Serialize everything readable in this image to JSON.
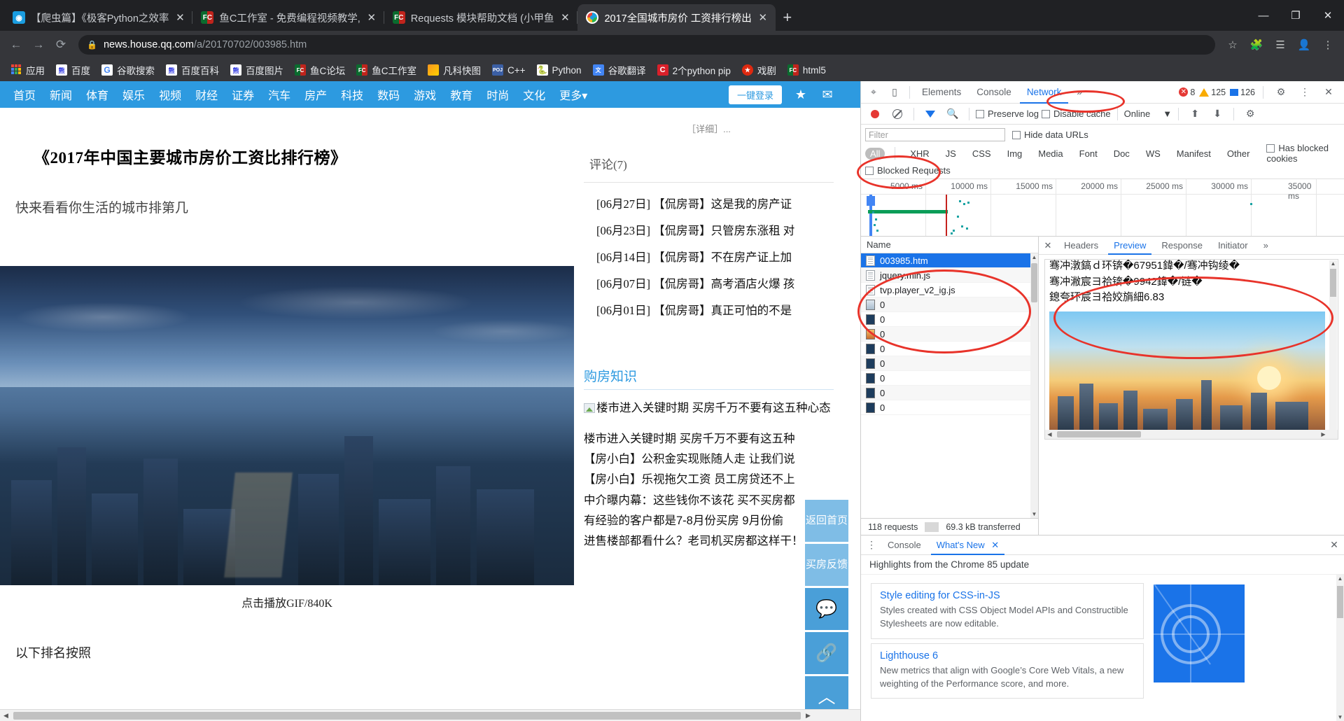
{
  "window": {
    "minimize": "—",
    "maximize": "❐",
    "close": "✕"
  },
  "tabs": [
    {
      "title": "【爬虫篇】《极客Python之效率",
      "icon": "robot-icon",
      "active": false
    },
    {
      "title": "鱼C工作室 - 免费编程视频教学,",
      "icon": "fc-icon",
      "active": false
    },
    {
      "title": "Requests 模块帮助文档 (小甲鱼",
      "icon": "fc-icon",
      "active": false
    },
    {
      "title": "2017全国城市房价 工资排行榜出",
      "icon": "qq-icon",
      "active": true
    }
  ],
  "newtab_label": "+",
  "toolbar": {
    "back": "←",
    "forward": "→",
    "reload": "⟳",
    "lock": "🔒",
    "url_host": "news.house.qq.com",
    "url_path": "/a/20170702/003985.htm",
    "star": "☆",
    "extensions": "🧩",
    "reading_list": "☰",
    "profile": "👤",
    "menu": "⋮"
  },
  "bookmarks": [
    {
      "label": "应用",
      "icon": "apps-grid-icon",
      "type": "apps"
    },
    {
      "label": "百度",
      "icon": "baidu-icon",
      "type": "baidu"
    },
    {
      "label": "谷歌搜索",
      "icon": "google-icon",
      "type": "google"
    },
    {
      "label": "百度百科",
      "icon": "baidu-icon",
      "type": "baidu"
    },
    {
      "label": "百度图片",
      "icon": "baidu-icon",
      "type": "baidu"
    },
    {
      "label": "鱼C论坛",
      "icon": "fc-icon",
      "type": "fc"
    },
    {
      "label": "鱼C工作室",
      "icon": "fc-icon",
      "type": "fc"
    },
    {
      "label": "凡科快图",
      "icon": "fanke-icon",
      "type": "fan"
    },
    {
      "label": "C++",
      "icon": "poj-icon",
      "type": "poj"
    },
    {
      "label": "Python",
      "icon": "python-icon",
      "type": "py"
    },
    {
      "label": "谷歌翻译",
      "icon": "google-translate-icon",
      "type": "gt"
    },
    {
      "label": "2个python pip",
      "icon": "c-icon",
      "type": "c"
    },
    {
      "label": "戏剧",
      "icon": "china-icon",
      "type": "cn"
    },
    {
      "label": "html5",
      "icon": "fc-icon",
      "type": "h5"
    }
  ],
  "page": {
    "nav": [
      "首页",
      "新闻",
      "体育",
      "娱乐",
      "视频",
      "财经",
      "证券",
      "汽车",
      "房产",
      "科技",
      "数码",
      "游戏",
      "教育",
      "时尚",
      "文化",
      "更多▾"
    ],
    "login_button": "一键登录",
    "star_icon": "star-icon",
    "mail_icon": "mail-icon",
    "article_title": "《2017年中国主要城市房价工资比排行榜》",
    "article_sub": "快来看看你生活的城市排第几",
    "image_caption": "点击播放GIF/840K",
    "article_footer": "以下排名按照",
    "comments_header": "评论(7)",
    "comments": [
      "[06月27日] 【侃房哥】这是我的房产证",
      "[06月23日] 【侃房哥】只管房东涨租 对",
      "[06月14日] 【侃房哥】不在房产证上加",
      "[06月07日] 【侃房哥】高考酒店火爆 孩",
      "[06月01日] 【侃房哥】真正可怕的不是"
    ],
    "section_title": "购房知识",
    "knowledge_lead": "楼市进入关键时期 买房千万不要有这五种心态",
    "knowledge_list": [
      "楼市进入关键时期 买房千万不要有这五种",
      "【房小白】公积金实现账随人走 让我们说",
      "【房小白】乐视拖欠工资 员工房贷还不上",
      "中介曝内幕：这些钱你不该花 买不买房都",
      "有经验的客户都是7-8月份买房 9月份偷",
      "进售楼部都看什么？老司机买房都这样干！"
    ],
    "side_buttons": [
      {
        "label": "返回首页",
        "name": "back-to-home-button"
      },
      {
        "label": "买房反馈",
        "name": "feedback-button"
      },
      {
        "label": "💬",
        "name": "comment-icon"
      },
      {
        "label": "🔗",
        "name": "link-icon"
      },
      {
        "label": "︿",
        "name": "scroll-top-icon"
      }
    ]
  },
  "devtools": {
    "inspect_icon": "inspect-cursor-icon",
    "device_icon": "device-toolbar-icon",
    "tabs": [
      "Elements",
      "Console",
      "Network"
    ],
    "more_tabs": "»",
    "active_tab": "Network",
    "errors": "8",
    "warnings": "125",
    "messages": "126",
    "settings_icon": "gear-icon",
    "kebab_icon": "more-vertical-icon",
    "close_icon": "close-icon",
    "network_toolbar": {
      "record_icon": "record-dot-icon",
      "clear_icon": "clear-icon",
      "filter_icon": "funnel-icon",
      "search_icon": "search-icon",
      "preserve_log": "Preserve log",
      "disable_cache": "Disable cache",
      "throttling": "Online",
      "throttling_caret": "▼",
      "import_icon": "import-har-icon",
      "export_icon": "export-har-icon",
      "network_settings_icon": "gear-icon"
    },
    "filter_placeholder": "Filter",
    "hide_data_urls": "Hide data URLs",
    "types": [
      "All",
      "XHR",
      "JS",
      "CSS",
      "Img",
      "Media",
      "Font",
      "Doc",
      "WS",
      "Manifest",
      "Other"
    ],
    "active_type": "All",
    "has_blocked_cookies": "Has blocked cookies",
    "blocked_requests": "Blocked Requests",
    "timeline_ticks": [
      "5000 ms",
      "10000 ms",
      "15000 ms",
      "20000 ms",
      "25000 ms",
      "30000 ms",
      "35000 ms"
    ],
    "requests_column": "Name",
    "requests": [
      {
        "name": "003985.htm",
        "kind": "doc",
        "selected": true
      },
      {
        "name": "jquery.min.js",
        "kind": "doc",
        "selected": false
      },
      {
        "name": "tvp.player_v2_ig.js",
        "kind": "doc",
        "selected": false
      },
      {
        "name": "0",
        "kind": "img3",
        "selected": false
      },
      {
        "name": "0",
        "kind": "img",
        "selected": false
      },
      {
        "name": "0",
        "kind": "img2",
        "selected": false
      },
      {
        "name": "0",
        "kind": "img",
        "selected": false
      },
      {
        "name": "0",
        "kind": "img",
        "selected": false
      },
      {
        "name": "0",
        "kind": "img",
        "selected": false
      },
      {
        "name": "0",
        "kind": "img",
        "selected": false
      },
      {
        "name": "0",
        "kind": "img",
        "selected": false
      }
    ],
    "requests_count": "118 requests",
    "transferred": "69.3 kB transferred",
    "detail_tabs": [
      "Headers",
      "Preview",
      "Response",
      "Initiator"
    ],
    "detail_more": "»",
    "detail_active": "Preview",
    "detail_close": "✕",
    "preview_lines": [
      "骞冲潡鎬ｄ环锛�67951鍏�/骞冲钩绫�",
      "骞冲潎宸ヨ祫锛�9942鍏�/链�",
      "鎴夸环宸ヨ祫姣旓細6.83"
    ],
    "drawer": {
      "kebab": "⋮",
      "tabs": [
        "Console",
        "What's New"
      ],
      "active": "What's New",
      "tab_close": "✕",
      "close": "✕",
      "subtitle": "Highlights from the Chrome 85 update",
      "cards": [
        {
          "title": "Style editing for CSS-in-JS",
          "body": "Styles created with CSS Object Model APIs and Constructible Stylesheets are now editable."
        },
        {
          "title": "Lighthouse 6",
          "body": "New metrics that align with Google’s Core Web Vitals, a new weighting of the Performance score, and more."
        }
      ]
    }
  },
  "colors": {
    "chrome_dark": "#202124",
    "chrome_toolbar": "#35363a",
    "accent_blue": "#1a73e8",
    "qq_blue": "#2d9ae0",
    "annotation_red": "#e8332a",
    "selected_row": "#1a73e8"
  }
}
